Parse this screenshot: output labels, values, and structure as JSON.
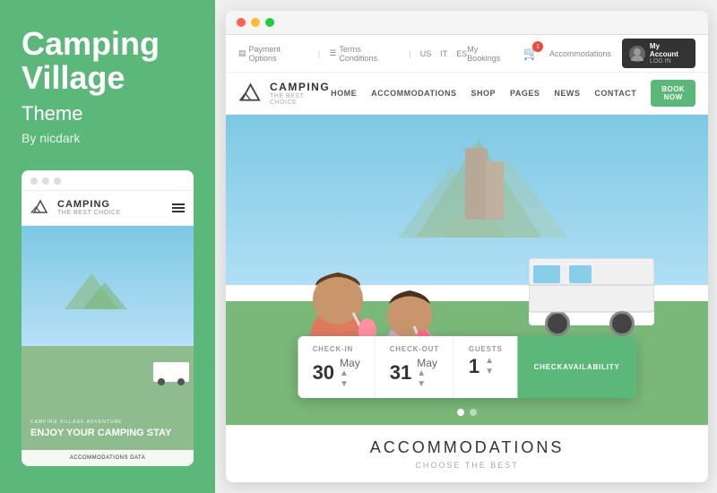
{
  "left": {
    "title_line1": "Camping",
    "title_line2": "Village",
    "subtitle": "Theme",
    "by": "By nicdark",
    "mini_browser": {
      "logo_main": "CAMPING",
      "logo_sub": "THE BEST CHOICE",
      "overlay_label": "CAMPING VILLAGE ADVENTURE",
      "overlay_title": "ENJOY YOUR CAMPING STAY",
      "accommodations_bar": "ACCOMMODATIONS DATA"
    }
  },
  "right": {
    "topbar": {
      "payment_options": "Payment Options",
      "terms_conditions": "Terms Conditions",
      "lang_us": "US",
      "lang_it": "IT",
      "lang_es": "ES",
      "my_bookings": "My Bookings",
      "cart_count": "1",
      "accommodations": "Accommodations",
      "account_label": "My Account",
      "account_sub": "LOG IN"
    },
    "nav": {
      "logo_main": "CAMPING",
      "logo_sub": "THE BEST CHOICE",
      "links": [
        "HOME",
        "ACCOMMODATIONS",
        "SHOP",
        "PAGES",
        "NEWS",
        "CONTACT"
      ],
      "book_now": "BOOK NOW"
    },
    "booking": {
      "checkin_label": "CHECK-IN",
      "checkin_day": "30",
      "checkin_month": "May",
      "checkout_label": "CHECK-OUT",
      "checkout_day": "31",
      "checkout_month": "May",
      "guests_label": "GUESTS",
      "guests_count": "1",
      "check_btn_line1": "CHECK",
      "check_btn_line2": "AVAILABILITY"
    },
    "accommodations": {
      "title": "ACCOMMODATIONS",
      "subtitle": "CHOOSE THE BEST"
    }
  },
  "colors": {
    "green": "#5cb87a",
    "dark": "#333",
    "light_gray": "#f5f5f5",
    "text_gray": "#888"
  }
}
